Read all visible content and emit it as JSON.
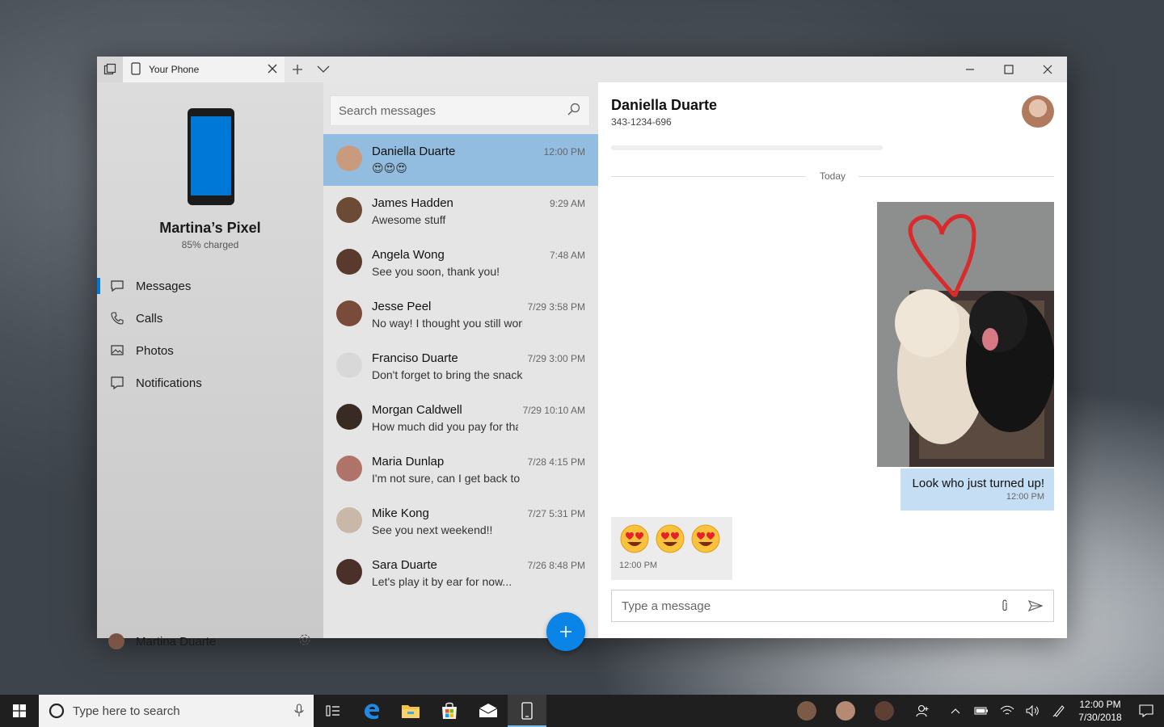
{
  "titlebar": {
    "tab_title": "Your Phone"
  },
  "device": {
    "name": "Martina’s Pixel",
    "status": "85% charged"
  },
  "nav": {
    "items": [
      {
        "label": "Messages",
        "icon": "message-icon"
      },
      {
        "label": "Calls",
        "icon": "phone-icon"
      },
      {
        "label": "Photos",
        "icon": "photos-icon"
      },
      {
        "label": "Notifications",
        "icon": "notification-icon"
      }
    ],
    "active": "Messages"
  },
  "user": {
    "name": "Martina Duarte"
  },
  "search": {
    "placeholder": "Search messages"
  },
  "conversations": [
    {
      "name": "Daniella Duarte",
      "preview": "😍😍😍",
      "time": "12:00 PM",
      "selected": true,
      "avatar_color": "#c89a7e"
    },
    {
      "name": "James Hadden",
      "preview": "Awesome stuff",
      "time": "9:29 AM",
      "avatar_color": "#6b4a36"
    },
    {
      "name": "Angela Wong",
      "preview": "See you soon, thank you!",
      "time": "7:48 AM",
      "avatar_color": "#5a3a2c"
    },
    {
      "name": "Jesse Peel",
      "preview": "No way! I thought you still worked at th",
      "time": "7/29 3:58 PM",
      "avatar_color": "#7a4a3a"
    },
    {
      "name": "Franciso Duarte",
      "preview": "Don't forget to bring the snacks!",
      "time": "7/29 3:00 PM",
      "avatar_color": "#d8d8d8"
    },
    {
      "name": "Morgan Caldwell",
      "preview": "How much did you pay for that?",
      "time": "7/29 10:10 AM",
      "avatar_color": "#3a2a24"
    },
    {
      "name": "Maria Dunlap",
      "preview": "I'm not sure, can I get back to you?",
      "time": "7/28 4:15 PM",
      "avatar_color": "#b0736a"
    },
    {
      "name": "Mike Kong",
      "preview": "See you next weekend!!",
      "time": "7/27 5:31 PM",
      "avatar_color": "#c9b8a8"
    },
    {
      "name": "Sara Duarte",
      "preview": "Let's play it by ear for now...",
      "time": "7/26 8:48 PM",
      "avatar_color": "#4a3028"
    }
  ],
  "chat": {
    "name": "Daniella Duarte",
    "number": "343-1234-696",
    "divider_label": "Today",
    "outgoing": {
      "text": "Look who just turned up!",
      "time": "12:00 PM"
    },
    "incoming": {
      "emojis": [
        "😍",
        "😍",
        "😍"
      ],
      "time": "12:00 PM"
    },
    "compose_placeholder": "Type a message"
  },
  "taskbar": {
    "search_placeholder": "Type here to search",
    "clock_time": "12:00 PM",
    "clock_date": "7/30/2018"
  },
  "colors": {
    "accent": "#0078d7",
    "selected": "#93bde0",
    "bubble_out": "#c6def3",
    "fab": "#0a84e6"
  }
}
